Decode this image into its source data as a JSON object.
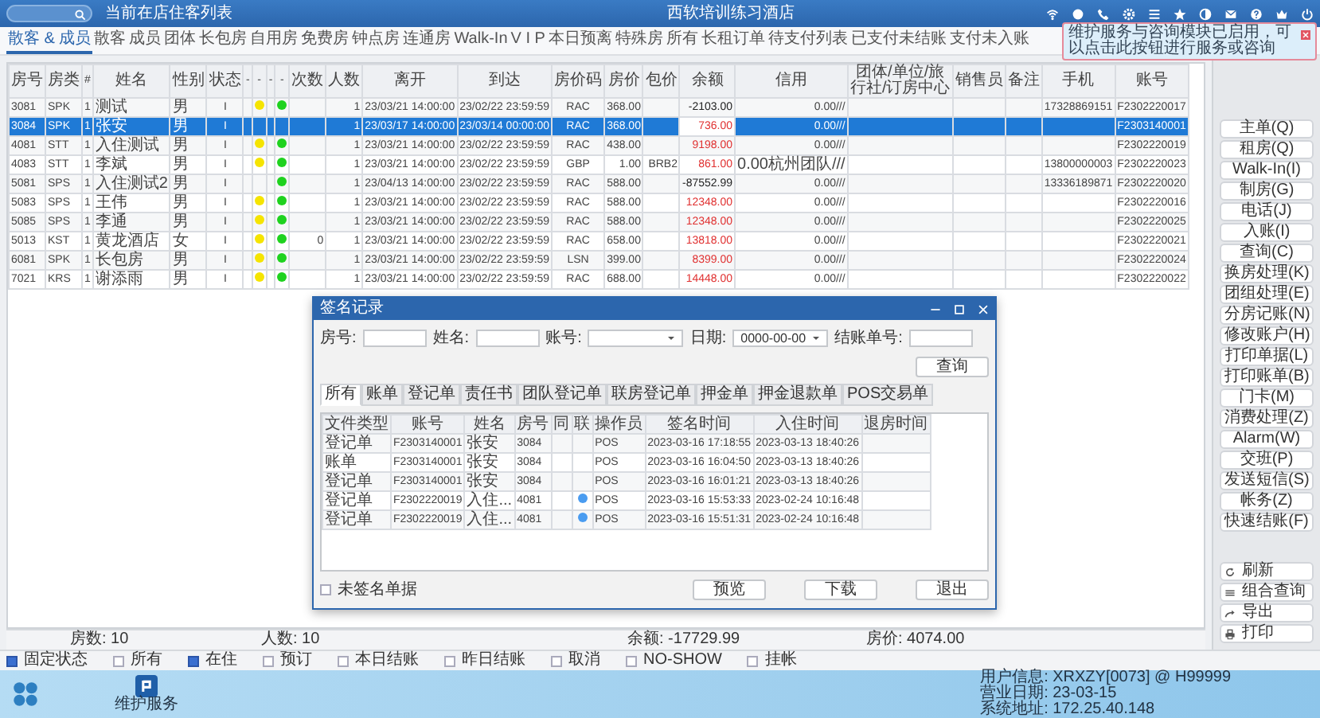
{
  "header": {
    "caption": "当前在店住客列表",
    "title": "西软培训练习酒店"
  },
  "tooltip": {
    "text": "维护服务与咨询模块已启用，可以点击此按钮进行服务或咨询"
  },
  "tabs": [
    {
      "label": "散客 & 成员",
      "selected": true
    },
    {
      "label": "散客",
      "selected": false
    },
    {
      "label": "成员",
      "selected": false
    },
    {
      "label": "团体",
      "selected": false
    },
    {
      "label": "长包房",
      "selected": false
    },
    {
      "label": "自用房",
      "selected": false
    },
    {
      "label": "免费房",
      "selected": false
    },
    {
      "label": "钟点房",
      "selected": false
    },
    {
      "label": "连通房",
      "selected": false
    },
    {
      "label": "Walk-In",
      "selected": false
    },
    {
      "label": "V I P",
      "selected": false
    },
    {
      "label": "本日预离",
      "selected": false
    },
    {
      "label": "特殊房",
      "selected": false
    },
    {
      "label": "所有",
      "selected": false
    },
    {
      "label": "长租订单",
      "selected": false
    },
    {
      "label": "待支付列表",
      "selected": false
    },
    {
      "label": "已支付未结账",
      "selected": false
    },
    {
      "label": "支付未入账",
      "selected": false
    }
  ],
  "table": {
    "columns": [
      "房号",
      "房类",
      "#",
      "姓名",
      "性别",
      "状态",
      "-",
      "-",
      "-",
      "-",
      "次数",
      "人数",
      "离开",
      "到达",
      "房价码",
      "房价",
      "包价",
      "余额",
      "信用",
      "团体/单位/旅行社/订房中心",
      "销售员",
      "备注",
      "手机",
      "账号"
    ],
    "rows": [
      {
        "selected": false,
        "dot_yellow": true,
        "dot_green": true,
        "balance": {
          "text": "-2103.00",
          "color": "#222222"
        },
        "cells": [
          "3081",
          "SPK",
          "1",
          "测试",
          "男",
          "I",
          null,
          null,
          null,
          null,
          null,
          "1",
          "23/03/21 14:00:00",
          "23/02/22 23:59:59",
          "RAC",
          "368.00",
          null,
          null,
          "0.00///",
          null,
          null,
          null,
          "17328869151",
          "F2302220017"
        ]
      },
      {
        "selected": true,
        "dot_yellow": false,
        "dot_green": false,
        "balance": {
          "text": "736.00",
          "color": "#e03030"
        },
        "cells": [
          "3084",
          "SPK",
          "1",
          "张安",
          "男",
          "I",
          null,
          null,
          null,
          null,
          null,
          "1",
          "23/03/17 14:00:00",
          "23/03/14 00:00:00",
          "RAC",
          "368.00",
          null,
          null,
          "0.00///",
          null,
          null,
          null,
          null,
          "F2303140001"
        ]
      },
      {
        "selected": false,
        "dot_yellow": true,
        "dot_green": true,
        "balance": {
          "text": "9198.00",
          "color": "#e03030"
        },
        "cells": [
          "4081",
          "STT",
          "1",
          "入住测试",
          "男",
          "I",
          null,
          null,
          null,
          null,
          null,
          "1",
          "23/03/21 14:00:00",
          "23/02/22 23:59:59",
          "RAC",
          "438.00",
          null,
          null,
          "0.00///",
          null,
          null,
          null,
          null,
          "F2302220019"
        ]
      },
      {
        "selected": false,
        "dot_yellow": true,
        "dot_green": true,
        "balance": {
          "text": "861.00",
          "color": "#e03030"
        },
        "cells": [
          "4083",
          "STT",
          "1",
          "李斌",
          "男",
          "I",
          null,
          null,
          null,
          null,
          null,
          "1",
          "23/03/21 14:00:00",
          "23/02/22 23:59:59",
          "GBP",
          "1.00",
          "BRB2",
          null,
          "0.00杭州团队///",
          null,
          null,
          null,
          "13800000003",
          "F2302220023"
        ]
      },
      {
        "selected": false,
        "dot_yellow": false,
        "dot_green": true,
        "balance": {
          "text": "-87552.99",
          "color": "#222222"
        },
        "cells": [
          "5081",
          "SPS",
          "1",
          "入住测试2",
          "男",
          "I",
          null,
          null,
          null,
          null,
          null,
          "1",
          "23/04/13 14:00:00",
          "23/02/22 23:59:59",
          "RAC",
          "588.00",
          null,
          null,
          "0.00///",
          null,
          null,
          null,
          "13336189871",
          "F2302220020"
        ]
      },
      {
        "selected": false,
        "dot_yellow": true,
        "dot_green": true,
        "balance": {
          "text": "12348.00",
          "color": "#e03030"
        },
        "cells": [
          "5083",
          "SPS",
          "1",
          "王伟",
          "男",
          "I",
          null,
          null,
          null,
          null,
          null,
          "1",
          "23/03/21 14:00:00",
          "23/02/22 23:59:59",
          "RAC",
          "588.00",
          null,
          null,
          "0.00///",
          null,
          null,
          null,
          null,
          "F2302220016"
        ]
      },
      {
        "selected": false,
        "dot_yellow": true,
        "dot_green": true,
        "balance": {
          "text": "12348.00",
          "color": "#e03030"
        },
        "cells": [
          "5085",
          "SPS",
          "1",
          "李通",
          "男",
          "I",
          null,
          null,
          null,
          null,
          null,
          "1",
          "23/03/21 14:00:00",
          "23/02/22 23:59:59",
          "RAC",
          "588.00",
          null,
          null,
          "0.00///",
          null,
          null,
          null,
          null,
          "F2302220025"
        ]
      },
      {
        "selected": false,
        "dot_yellow": true,
        "dot_green": true,
        "balance": {
          "text": "13818.00",
          "color": "#e03030"
        },
        "cells": [
          "5013",
          "KST",
          "1",
          "黄龙酒店",
          "女",
          "I",
          null,
          null,
          null,
          null,
          "0",
          "1",
          "23/03/21 14:00:00",
          "23/02/22 23:59:59",
          "RAC",
          "658.00",
          null,
          null,
          "0.00///",
          null,
          null,
          null,
          null,
          "F2302220021"
        ]
      },
      {
        "selected": false,
        "dot_yellow": true,
        "dot_green": true,
        "balance": {
          "text": "8399.00",
          "color": "#e03030"
        },
        "cells": [
          "6081",
          "SPK",
          "1",
          "长包房",
          "男",
          "I",
          null,
          null,
          null,
          null,
          null,
          "1",
          "23/03/21 14:00:00",
          "23/02/22 23:59:59",
          "LSN",
          "399.00",
          null,
          null,
          "0.00///",
          null,
          null,
          null,
          null,
          "F2302220024"
        ]
      },
      {
        "selected": false,
        "dot_yellow": true,
        "dot_green": true,
        "balance": {
          "text": "14448.00",
          "color": "#e03030"
        },
        "cells": [
          "7021",
          "KRS",
          "1",
          "谢添雨",
          "男",
          "I",
          null,
          null,
          null,
          null,
          null,
          "1",
          "23/03/21 14:00:00",
          "23/02/22 23:59:59",
          "RAC",
          "688.00",
          null,
          null,
          "0.00///",
          null,
          null,
          null,
          null,
          "F2302220022"
        ]
      }
    ]
  },
  "summary": [
    "房数: 10",
    "人数: 10",
    "余额: -17729.99",
    "房价: 4074.00"
  ],
  "actions": [
    "主单(Q)",
    "租房(Q)",
    "Walk-In(I)",
    "制房(G)",
    "电话(J)",
    "入账(I)",
    "查询(C)",
    "换房处理(K)",
    "团组处理(E)",
    "分房记账(N)",
    "修改账户(H)",
    "打印单据(L)",
    "打印账单(B)",
    "门卡(M)",
    "消费处理(Z)",
    "Alarm(W)",
    "交班(P)",
    "发送短信(S)",
    "帐务(Z)",
    "快速结账(F)"
  ],
  "bottom_actions": [
    {
      "kind": "refresh",
      "label": "刷新"
    },
    {
      "kind": "list",
      "label": "组合查询"
    },
    {
      "kind": "export",
      "label": "导出"
    },
    {
      "kind": "print",
      "label": "打印"
    }
  ],
  "filters": [
    {
      "label": "固定状态",
      "checked": true
    },
    {
      "label": "所有",
      "checked": false
    },
    {
      "label": "在住",
      "checked": true
    },
    {
      "label": "预订",
      "checked": false
    },
    {
      "label": "本日结账",
      "checked": false
    },
    {
      "label": "昨日结账",
      "checked": false
    },
    {
      "label": "取消",
      "checked": false
    },
    {
      "label": "NO-SHOW",
      "checked": false
    },
    {
      "label": "挂帐",
      "checked": false
    }
  ],
  "taskbar": {
    "apps": [
      {
        "label": "维护服务"
      }
    ],
    "info": [
      "用户信息: XRXZY[0073] @ H99999",
      "营业日期: 23-03-15",
      "系统地址: 172.25.40.148"
    ]
  },
  "dialog": {
    "title": "签名记录",
    "fields": [
      {
        "kind": "text",
        "label": "房号:"
      },
      {
        "kind": "text",
        "label": "姓名:"
      },
      {
        "kind": "select",
        "label": "账号:"
      },
      {
        "kind": "select",
        "label": "日期:",
        "value": "0000-00-00"
      },
      {
        "kind": "text",
        "label": "结账单号:"
      }
    ],
    "query_button": "查询",
    "tabs": [
      {
        "label": "所有",
        "selected": true
      },
      {
        "label": "账单",
        "selected": false
      },
      {
        "label": "登记单",
        "selected": false
      },
      {
        "label": "责任书",
        "selected": false
      },
      {
        "label": "团队登记单",
        "selected": false
      },
      {
        "label": "联房登记单",
        "selected": false
      },
      {
        "label": "押金单",
        "selected": false
      },
      {
        "label": "押金退款单",
        "selected": false
      },
      {
        "label": "POS交易单",
        "selected": false
      }
    ],
    "columns": [
      "文件类型",
      "账号",
      "姓名",
      "房号",
      "同",
      "联",
      "操作员",
      "签名时间",
      "入住时间",
      "退房时间"
    ],
    "rows": [
      {
        "linked": false,
        "cells": [
          "登记单",
          "F2303140001",
          "张安",
          "3084",
          null,
          null,
          "POS",
          "2023-03-16 17:18:55",
          "2023-03-13 18:40:26",
          null
        ]
      },
      {
        "linked": false,
        "cells": [
          "账单",
          "F2303140001",
          "张安",
          "3084",
          null,
          null,
          "POS",
          "2023-03-16 16:04:50",
          "2023-03-13 18:40:26",
          null
        ]
      },
      {
        "linked": false,
        "cells": [
          "登记单",
          "F2303140001",
          "张安",
          "3084",
          null,
          null,
          "POS",
          "2023-03-16 16:01:21",
          "2023-03-13 18:40:26",
          null
        ]
      },
      {
        "linked": true,
        "cells": [
          "登记单",
          "F2302220019",
          "入住...",
          "4081",
          null,
          null,
          "POS",
          "2023-03-16 15:53:33",
          "2023-02-24 10:16:48",
          null
        ]
      },
      {
        "linked": true,
        "cells": [
          "登记单",
          "F2302220019",
          "入住...",
          "4081",
          null,
          null,
          "POS",
          "2023-03-16 15:51:31",
          "2023-02-24 10:16:48",
          null
        ]
      }
    ],
    "unsigned": {
      "label": "未签名单据",
      "checked": false
    },
    "buttons": [
      "预览",
      "下载",
      "退出"
    ]
  }
}
